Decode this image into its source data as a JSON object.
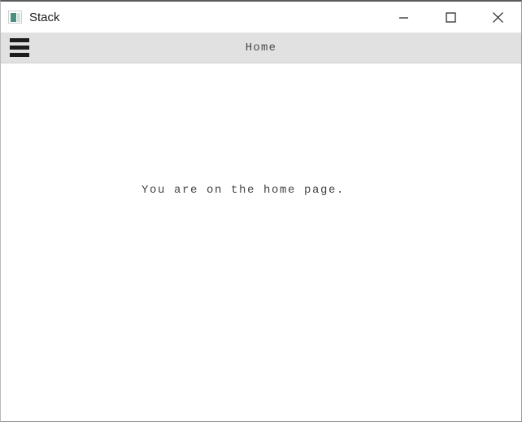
{
  "window": {
    "title": "Stack",
    "icon": "app-icon",
    "controls": [
      {
        "name": "minimize",
        "glyph": "minimize-icon",
        "label": "Minimize"
      },
      {
        "name": "maximize",
        "glyph": "maximize-icon",
        "label": "Maximize"
      },
      {
        "name": "close",
        "glyph": "close-icon",
        "label": "Close"
      }
    ]
  },
  "toolbar": {
    "menu_icon": "hamburger-menu-icon",
    "title": "Home"
  },
  "content": {
    "message": "You are on the home page."
  },
  "colors": {
    "titlebar_bg": "#ffffff",
    "toolbar_bg": "#e1e1e1",
    "content_bg": "#ffffff",
    "title_text": "#1b1b1b",
    "toolbar_title_text": "#4a4a4a",
    "content_text": "#454545",
    "menu_icon": "#1d1d1f",
    "app_icon_accent": "#4a8f80",
    "window_border_top": "#5a5a5e"
  }
}
